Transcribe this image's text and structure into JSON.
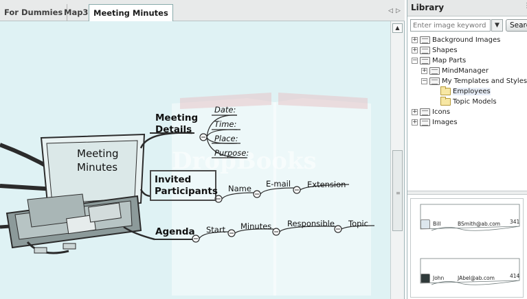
{
  "tabs": {
    "items": [
      {
        "label": "For Dummies"
      },
      {
        "label": "Map3"
      },
      {
        "label": "Meeting Minutes"
      }
    ],
    "nav_left": "◁",
    "nav_right": "▷",
    "close": "×"
  },
  "map": {
    "central_topic": {
      "line1": "Meeting",
      "line2": "Minutes"
    },
    "watermark": "DropBooks",
    "topics": {
      "details": {
        "line1": "Meeting",
        "line2": "Details",
        "subtopics": [
          "Date:",
          "Time:",
          "Place:",
          "Purpose:"
        ]
      },
      "participants": {
        "line1": "Invited",
        "line2": "Participants",
        "subtopics": [
          "Name",
          "E-mail",
          "Extension"
        ]
      },
      "agenda": {
        "label": "Agenda",
        "subtopics": [
          "Start",
          "Minutes",
          "Responsible",
          "Topic"
        ]
      }
    },
    "colors": {
      "background": "#dff2f4",
      "line": "#2b2b2b"
    }
  },
  "library": {
    "title": "Library",
    "search_placeholder": "Enter image keyword",
    "search_button": "Search",
    "tree": [
      {
        "label": "Background Images",
        "expander": "+",
        "icon": "library-book-icon"
      },
      {
        "label": "Shapes",
        "expander": "+",
        "icon": "library-book-icon"
      },
      {
        "label": "Map Parts",
        "expander": "−",
        "icon": "library-book-icon"
      },
      {
        "label": "MindManager",
        "expander": "+",
        "icon": "library-book-icon"
      },
      {
        "label": "My Templates and Styles",
        "expander": "−",
        "icon": "library-book-icon"
      },
      {
        "label": "Employees",
        "expander": "",
        "icon": "folder-icon"
      },
      {
        "label": "Topic Models",
        "expander": "",
        "icon": "folder-icon"
      },
      {
        "label": "Icons",
        "expander": "+",
        "icon": "library-book-icon"
      },
      {
        "label": "Images",
        "expander": "+",
        "icon": "library-book-icon"
      }
    ],
    "preview_cards": [
      {
        "name": "Bill",
        "email": "BSmith@ab.com",
        "ext": "341"
      },
      {
        "name": "John",
        "email": "JAbel@ab.com",
        "ext": "414"
      }
    ]
  }
}
